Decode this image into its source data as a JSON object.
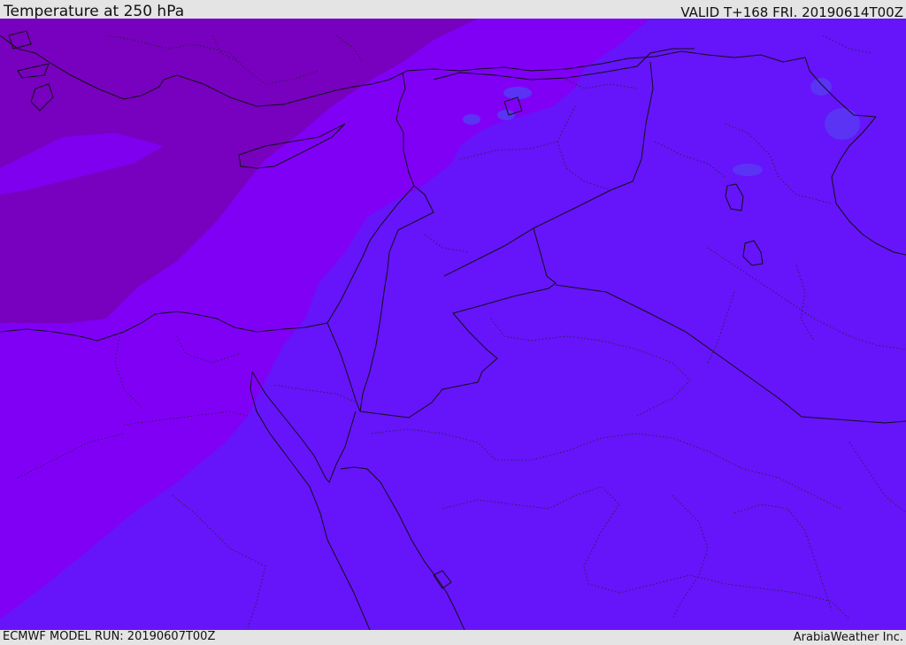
{
  "header": {
    "title": "Temperature at 250 hPa",
    "valid": "VALID T+168 FRI. 20190614T00Z"
  },
  "footer": {
    "model_run": "ECMWF MODEL RUN: 20190607T00Z",
    "credit": "ArabiaWeather Inc."
  },
  "map": {
    "field": "temperature",
    "pressure_level": "250 hPa",
    "region": "Eastern Mediterranean, Levant, Iraq, Egypt and northern Saudi Arabia",
    "legend_visible": false,
    "shading_colors": {
      "coldest_band": "#7800bf",
      "cold_band": "#8000f6",
      "base_band": "#6614fa",
      "warm_patches": "#5a33f4"
    },
    "border_color": "#111111"
  }
}
